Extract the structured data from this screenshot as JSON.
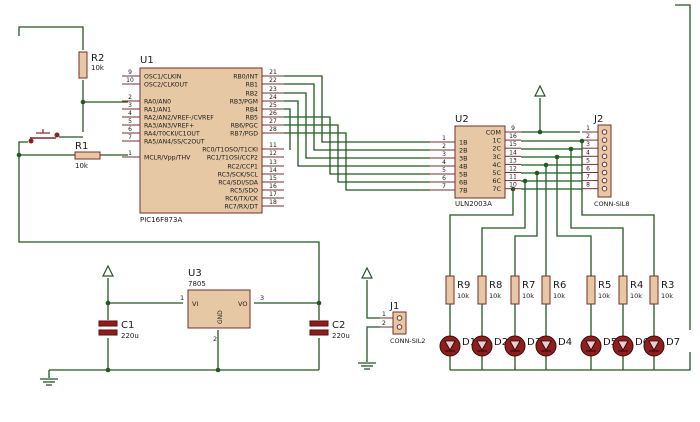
{
  "u1": {
    "ref": "U1",
    "part": "PIC16F873A",
    "left_pins": [
      {
        "num": "9",
        "name": "OSC1/CLKIN"
      },
      {
        "num": "10",
        "name": "OSC2/CLKOUT"
      },
      {
        "num": "2",
        "name": "RA0/AN0"
      },
      {
        "num": "3",
        "name": "RA1/AN1"
      },
      {
        "num": "4",
        "name": "RA2/AN2/VREF-/CVREF"
      },
      {
        "num": "5",
        "name": "RA3/AN3/VREF+"
      },
      {
        "num": "6",
        "name": "RA4/T0CKI/C1OUT"
      },
      {
        "num": "7",
        "name": "RA5/AN4/SS/C2OUT"
      },
      {
        "num": "1",
        "name": "MCLR/Vpp/THV"
      }
    ],
    "right_pins": [
      {
        "num": "21",
        "name": "RB0/INT"
      },
      {
        "num": "22",
        "name": "RB1"
      },
      {
        "num": "23",
        "name": "RB2"
      },
      {
        "num": "24",
        "name": "RB3/PGM"
      },
      {
        "num": "25",
        "name": "RB4"
      },
      {
        "num": "26",
        "name": "RB5"
      },
      {
        "num": "27",
        "name": "RB6/PGC"
      },
      {
        "num": "28",
        "name": "RB7/PGD"
      },
      {
        "num": "11",
        "name": "RC0/T1OSO/T1CKI"
      },
      {
        "num": "12",
        "name": "RC1/T1OSI/CCP2"
      },
      {
        "num": "13",
        "name": "RC2/CCP1"
      },
      {
        "num": "14",
        "name": "RC3/SCK/SCL"
      },
      {
        "num": "15",
        "name": "RC4/SDI/SDA"
      },
      {
        "num": "16",
        "name": "RC5/SDO"
      },
      {
        "num": "17",
        "name": "RC6/TX/CK"
      },
      {
        "num": "18",
        "name": "RC7/RX/DT"
      }
    ]
  },
  "u2": {
    "ref": "U2",
    "part": "ULN2003A",
    "left_pins": [
      {
        "num": "1",
        "name": "1B"
      },
      {
        "num": "2",
        "name": "2B"
      },
      {
        "num": "3",
        "name": "3B"
      },
      {
        "num": "4",
        "name": "4B"
      },
      {
        "num": "5",
        "name": "5B"
      },
      {
        "num": "6",
        "name": "6B"
      },
      {
        "num": "7",
        "name": "7B"
      }
    ],
    "right_pins": [
      {
        "num": "9",
        "name": "COM"
      },
      {
        "num": "16",
        "name": "1C"
      },
      {
        "num": "15",
        "name": "2C"
      },
      {
        "num": "14",
        "name": "3C"
      },
      {
        "num": "13",
        "name": "4C"
      },
      {
        "num": "12",
        "name": "5C"
      },
      {
        "num": "11",
        "name": "6C"
      },
      {
        "num": "10",
        "name": "7C"
      }
    ]
  },
  "u3": {
    "ref": "U3",
    "part": "7805",
    "vi": "VI",
    "vo": "VO",
    "gnd": "GND",
    "pin_vi": "1",
    "pin_vo": "3",
    "pin_gnd": "2"
  },
  "j1": {
    "ref": "J1",
    "part": "CONN-SIL2",
    "pins": [
      "1",
      "2"
    ]
  },
  "j2": {
    "ref": "J2",
    "part": "CONN-SIL8",
    "pins": [
      "1",
      "2",
      "3",
      "4",
      "5",
      "6",
      "7",
      "8"
    ]
  },
  "r_top": {
    "ref": "R2",
    "value": "10k"
  },
  "r_reset": {
    "ref": "R1",
    "value": "10k"
  },
  "c1": {
    "ref": "C1",
    "value": "220u"
  },
  "c2": {
    "ref": "C2",
    "value": "220u"
  },
  "led_resistors": [
    {
      "ref": "R9",
      "value": "10k"
    },
    {
      "ref": "R8",
      "value": "10k"
    },
    {
      "ref": "R7",
      "value": "10k"
    },
    {
      "ref": "R6",
      "value": "10k"
    },
    {
      "ref": "R5",
      "value": "10k"
    },
    {
      "ref": "R4",
      "value": "10k"
    },
    {
      "ref": "R3",
      "value": "10k"
    }
  ],
  "leds": [
    "D1",
    "D2",
    "D3",
    "D4",
    "D5",
    "D6",
    "D7"
  ],
  "colors": {
    "wire": "#1f5a1f",
    "chip_body": "#e6c8a4",
    "pin": "#7a2b2b",
    "led": "#8f1e1e"
  }
}
